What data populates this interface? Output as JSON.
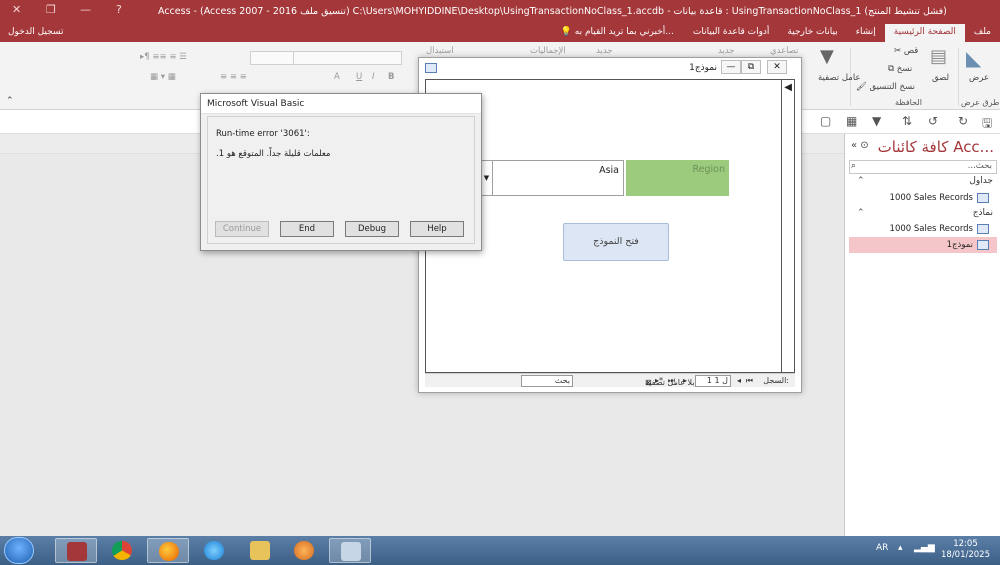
{
  "window": {
    "title": "Access - (Access 2007 - 2016 تنسيق ملف) C:\\Users\\MOHYIDDINE\\Desktop\\UsingTransactionNoClass_1.accdb - قاعدة بيانات : UsingTransactionNoClass_1 (فشل تنشيط المنتج)",
    "help_glyph": "?",
    "minimize_glyph": "—",
    "restore_glyph": "❐",
    "close_glyph": "✕"
  },
  "signin": "تسجيل الدخول",
  "tabs": [
    {
      "label": "ملف",
      "active": false
    },
    {
      "label": "الصفحة الرئيسية",
      "active": true
    },
    {
      "label": "إنشاء",
      "active": false
    },
    {
      "label": "بيانات خارجية",
      "active": false
    },
    {
      "label": "أدوات قاعدة البيانات",
      "active": false
    }
  ],
  "tell_me": "أخبرني بما تريد القيام به...",
  "ribbon": {
    "view_label": "عرض",
    "paste_label": "لصق",
    "cut_label": "قص",
    "copy_label": "نسخ",
    "format_painter_label": "نسخ التنسيق",
    "filter_label": "عامل تصفية",
    "group_views": "طرق عرض",
    "group_clipboard": "الحافظة",
    "ascending_label": "تصاعدي",
    "new_label": "جديد",
    "totals_label": "الإجماليات",
    "replace_label": "استبدال",
    "font_bold": "B",
    "font_italic": "I",
    "font_underline": "U",
    "font_a": "A"
  },
  "nav": {
    "title": "كافة كائنات Acc...",
    "search_placeholder": "بحث...",
    "groups": [
      {
        "label": "جداول",
        "items": [
          "1000 Sales Records"
        ]
      },
      {
        "label": "نماذج",
        "items": [
          "1000 Sales Records",
          "نموذج1"
        ]
      }
    ]
  },
  "form": {
    "title": "نموذج1",
    "region_label": "Region",
    "region_value": "Asia",
    "open_button": "فتح النموذج",
    "record_label": "السجل:",
    "record_value": "1 ل 1",
    "no_filter": "بلا عامل تصفية",
    "search": "بحث",
    "minimize_glyph": "—",
    "restore_glyph": "⧉",
    "close_glyph": "✕"
  },
  "dialog": {
    "title": "Microsoft Visual Basic",
    "error_title": "Run-time error '3061':",
    "error_message": ".معلمات قليلة جداً. المتوقع هو 1",
    "buttons": {
      "continue": "Continue",
      "end": "End",
      "debug": "Debug",
      "help": "Help"
    }
  },
  "taskbar": {
    "language": "AR",
    "time": "12:05",
    "date": "18/01/2025"
  },
  "colors": {
    "accent": "#a4373a",
    "region_green": "#9ccb7e",
    "button_blue": "#dce6f4",
    "nav_selected": "#f4c6c9"
  }
}
